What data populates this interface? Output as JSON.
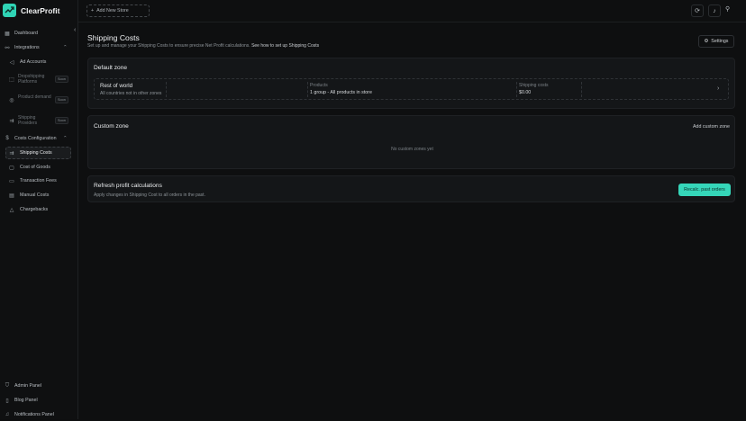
{
  "brand": {
    "name": "ClearProfit"
  },
  "topbar": {
    "add_store": "Add New Store"
  },
  "sidebar": {
    "items": [
      {
        "label": "Dashboard"
      },
      {
        "label": "Integrations"
      },
      {
        "label": "Ad Accounts"
      },
      {
        "label": "Dropshipping Platforms",
        "badge": "Soon"
      },
      {
        "label": "Product demand",
        "badge": "Soon"
      },
      {
        "label": "Shipping Providers",
        "badge": "Soon"
      },
      {
        "label": "Costs Configuration"
      },
      {
        "label": "Shipping Costs"
      },
      {
        "label": "Cost of Goods"
      },
      {
        "label": "Transaction Fees"
      },
      {
        "label": "Manual Costs"
      },
      {
        "label": "Chargebacks"
      }
    ],
    "bottom": [
      {
        "label": "Admin Panel"
      },
      {
        "label": "Blog Panel"
      },
      {
        "label": "Notifications Panel"
      }
    ]
  },
  "page": {
    "title": "Shipping Costs",
    "subtitle": "Set up and manage your Shipping Costs to ensure precise Net Profit calculations.",
    "help_link": "See how to set up Shipping Costs",
    "settings_label": "Settings"
  },
  "default_zone": {
    "title": "Default zone",
    "name": "Rest of world",
    "description": "All countries not in other zones",
    "products_label": "Products",
    "products_value": "1 group - All products in store",
    "shipping_label": "Shipping costs",
    "shipping_value": "$0.00"
  },
  "custom_zone": {
    "title": "Custom zone",
    "add_label": "Add custom zone",
    "empty_text": "No custom zones yet"
  },
  "refresh": {
    "title": "Refresh profit calculations",
    "subtitle": "Apply changes in Shipping Cost to all orders in the past.",
    "button": "Recalc. past orders"
  },
  "colors": {
    "accent": "#35d6b9",
    "background": "#0e0f10",
    "card": "#141618"
  }
}
